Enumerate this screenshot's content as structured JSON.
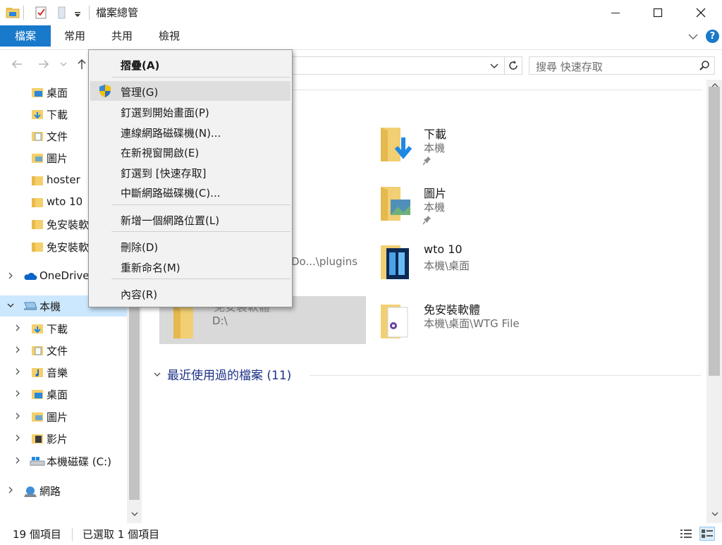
{
  "window": {
    "title": "檔案總管"
  },
  "ribbon": {
    "tabs": [
      {
        "label": "檔案",
        "active": true
      },
      {
        "label": "常用",
        "active": false
      },
      {
        "label": "共用",
        "active": false
      },
      {
        "label": "檢視",
        "active": false
      }
    ],
    "help_label": "?"
  },
  "search": {
    "placeholder": "搜尋 快速存取"
  },
  "sidebar": {
    "quick_access": [
      "桌面",
      "下載",
      "文件",
      "圖片",
      "hoster",
      "wto 10",
      "免安裝軟",
      "免安裝軟"
    ],
    "onedrive": "OneDrive",
    "this_pc": "本機",
    "this_pc_children": [
      "下載",
      "文件",
      "音樂",
      "桌面",
      "圖片",
      "影片",
      "本機磁碟 (C:)"
    ],
    "network": "網路"
  },
  "main": {
    "tiles": [
      {
        "name": "下載",
        "sub": "本機",
        "pinned": true
      },
      {
        "name": "圖片",
        "sub": "本機",
        "pinned": true
      },
      {
        "name": "wto 10",
        "sub": "本機\\桌面",
        "pinned": false
      },
      {
        "name": "免安裝軟體",
        "sub": "本機\\桌面\\WTG File",
        "pinned": false
      }
    ],
    "partial_tiles": [
      {
        "name": "",
        "sub": "Do...\\plugins"
      },
      {
        "name": "免安裝軟體",
        "sub": "D:\\"
      }
    ],
    "recent_header": "最近使用過的檔案 (11)"
  },
  "statusbar": {
    "item_count": "19 個項目",
    "selected": "已選取 1 個項目"
  },
  "context_menu": {
    "items": [
      {
        "label": "摺疊(A)",
        "bold": true
      },
      {
        "label": "管理(G)",
        "hover": true,
        "icon": "shield-icon"
      },
      {
        "label": "釘選到開始畫面(P)"
      },
      {
        "label": "連線網路磁碟機(N)..."
      },
      {
        "label": "在新視窗開啟(E)"
      },
      {
        "label": "釘選到 [快速存取]"
      },
      {
        "label": "中斷網路磁碟機(C)..."
      },
      {
        "label": "新增一個網路位置(L)"
      },
      {
        "label": "刪除(D)"
      },
      {
        "label": "重新命名(M)"
      },
      {
        "label": "內容(R)"
      }
    ]
  },
  "colors": {
    "accent": "#1979ca",
    "selection": "#cce8ff",
    "folder": "#f4cf6a",
    "download_arrow": "#1e88e5"
  }
}
